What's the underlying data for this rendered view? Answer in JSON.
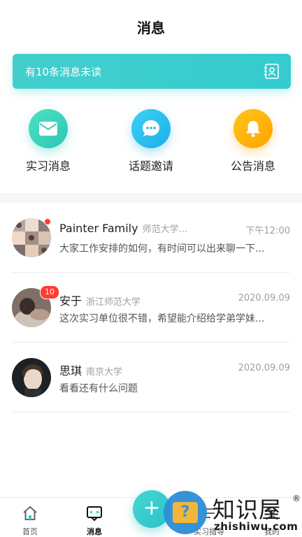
{
  "header": {
    "title": "消息"
  },
  "banner": {
    "text": "有10条消息未读",
    "icon": "contact-card-icon"
  },
  "quick_actions": [
    {
      "label": "实习消息",
      "icon": "mail-icon",
      "color": "#34cdb9"
    },
    {
      "label": "话题邀请",
      "icon": "chat-bubble-icon",
      "color": "#27b6ec"
    },
    {
      "label": "公告消息",
      "icon": "bell-icon",
      "color": "#ffb20a"
    }
  ],
  "messages": [
    {
      "name": "Painter Family",
      "school": "师范大学...",
      "time": "下午12:00",
      "preview": "大家工作安排的如何，有时间可以出来聊一下...",
      "unread_dot": true,
      "badge": ""
    },
    {
      "name": "安于",
      "school": "浙江师范大学",
      "time": "2020.09.09",
      "preview": "这次实习单位很不错，希望能介绍给学弟学妹...",
      "unread_dot": false,
      "badge": "10"
    },
    {
      "name": "思琪",
      "school": "南京大学",
      "time": "2020.09.09",
      "preview": "看看还有什么问题",
      "unread_dot": false,
      "badge": ""
    }
  ],
  "tabbar": {
    "home": "首页",
    "messages": "消息",
    "guide": "实习指导",
    "me": "我的",
    "active": "messages"
  },
  "watermark": {
    "cn": "知识屋",
    "en": "zhishiwu.com",
    "reg": "®"
  },
  "colors": {
    "accent": "#3ccbcc",
    "badge": "#ff3b30",
    "muted": "#9aa0a6"
  }
}
